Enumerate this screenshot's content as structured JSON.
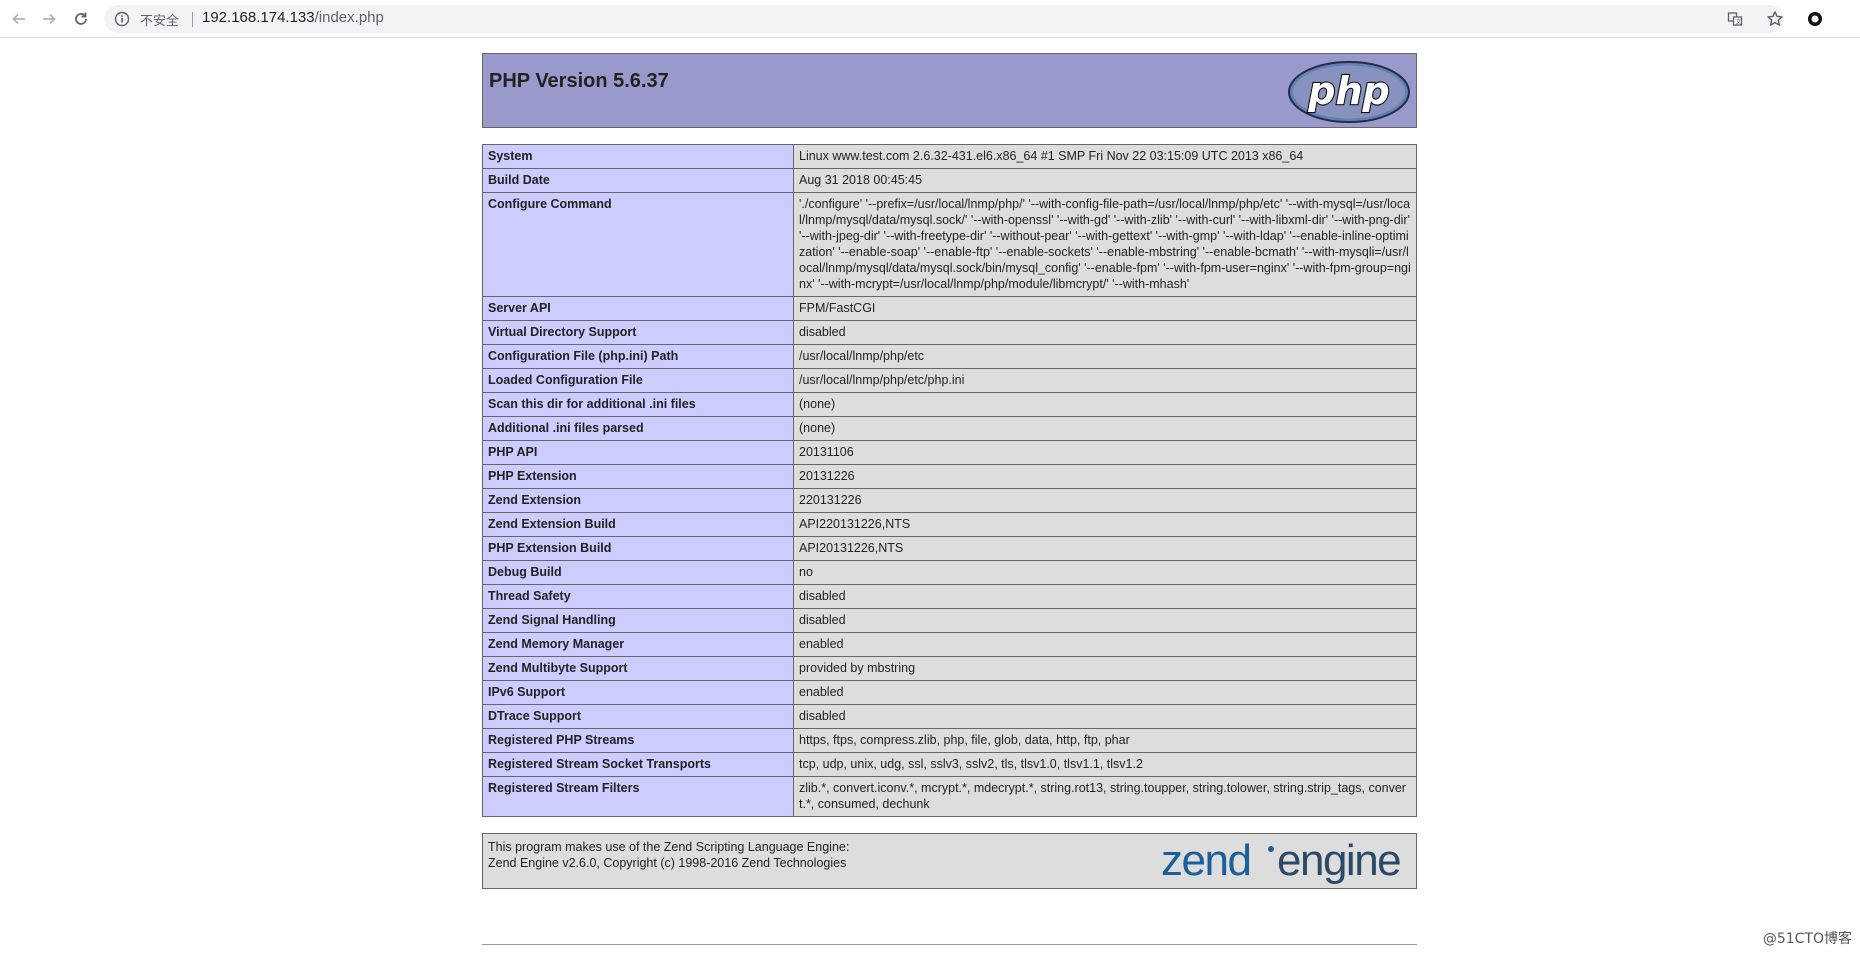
{
  "browser": {
    "security_label": "不安全",
    "url_host": "192.168.174.133",
    "url_path": "/index.php"
  },
  "page": {
    "title": "PHP Version 5.6.37",
    "logo_text": "php",
    "rows": [
      {
        "key": "System",
        "value": "Linux www.test.com 2.6.32-431.el6.x86_64 #1 SMP Fri Nov 22 03:15:09 UTC 2013 x86_64"
      },
      {
        "key": "Build Date",
        "value": "Aug 31 2018 00:45:45"
      },
      {
        "key": "Configure Command",
        "value": "'./configure' '--prefix=/usr/local/lnmp/php/' '--with-config-file-path=/usr/local/lnmp/php/etc' '--with-mysql=/usr/local/lnmp/mysql/data/mysql.sock/' '--with-openssl' '--with-gd' '--with-zlib' '--with-curl' '--with-libxml-dir' '--with-png-dir' '--with-jpeg-dir' '--with-freetype-dir' '--without-pear' '--with-gettext' '--with-gmp' '--with-ldap' '--enable-inline-optimization' '--enable-soap' '--enable-ftp' '--enable-sockets' '--enable-mbstring' '--enable-bcmath' '--with-mysqli=/usr/local/lnmp/mysql/data/mysql.sock/bin/mysql_config' '--enable-fpm' '--with-fpm-user=nginx' '--with-fpm-group=nginx' '--with-mcrypt=/usr/local/lnmp/php/module/libmcrypt/' '--with-mhash'"
      },
      {
        "key": "Server API",
        "value": "FPM/FastCGI"
      },
      {
        "key": "Virtual Directory Support",
        "value": "disabled"
      },
      {
        "key": "Configuration File (php.ini) Path",
        "value": "/usr/local/lnmp/php/etc"
      },
      {
        "key": "Loaded Configuration File",
        "value": "/usr/local/lnmp/php/etc/php.ini"
      },
      {
        "key": "Scan this dir for additional .ini files",
        "value": "(none)"
      },
      {
        "key": "Additional .ini files parsed",
        "value": "(none)"
      },
      {
        "key": "PHP API",
        "value": "20131106"
      },
      {
        "key": "PHP Extension",
        "value": "20131226"
      },
      {
        "key": "Zend Extension",
        "value": "220131226"
      },
      {
        "key": "Zend Extension Build",
        "value": "API220131226,NTS"
      },
      {
        "key": "PHP Extension Build",
        "value": "API20131226,NTS"
      },
      {
        "key": "Debug Build",
        "value": "no"
      },
      {
        "key": "Thread Safety",
        "value": "disabled"
      },
      {
        "key": "Zend Signal Handling",
        "value": "disabled"
      },
      {
        "key": "Zend Memory Manager",
        "value": "enabled"
      },
      {
        "key": "Zend Multibyte Support",
        "value": "provided by mbstring"
      },
      {
        "key": "IPv6 Support",
        "value": "enabled"
      },
      {
        "key": "DTrace Support",
        "value": "disabled"
      },
      {
        "key": "Registered PHP Streams",
        "value": "https, ftps, compress.zlib, php, file, glob, data, http, ftp, phar"
      },
      {
        "key": "Registered Stream Socket Transports",
        "value": "tcp, udp, unix, udg, ssl, sslv3, sslv2, tls, tlsv1.0, tlsv1.1, tlsv1.2"
      },
      {
        "key": "Registered Stream Filters",
        "value": "zlib.*, convert.iconv.*, mcrypt.*, mdecrypt.*, string.rot13, string.toupper, string.tolower, string.strip_tags, convert.*, consumed, dechunk"
      }
    ],
    "footer_line1": "This program makes use of the Zend Scripting Language Engine:",
    "footer_line2": "Zend Engine v2.6.0, Copyright (c) 1998-2016 Zend Technologies",
    "zend_logo_word1": "zend",
    "zend_logo_word2": "engine"
  },
  "watermark": "@51CTO博客",
  "colors": {
    "header_bg": "#9999cc",
    "key_bg": "#ccccff",
    "value_bg": "#dddddd",
    "border": "#666666"
  },
  "icons": [
    "back-arrow-icon",
    "forward-arrow-icon",
    "reload-icon",
    "info-icon",
    "translate-icon",
    "star-icon",
    "account-icon"
  ]
}
